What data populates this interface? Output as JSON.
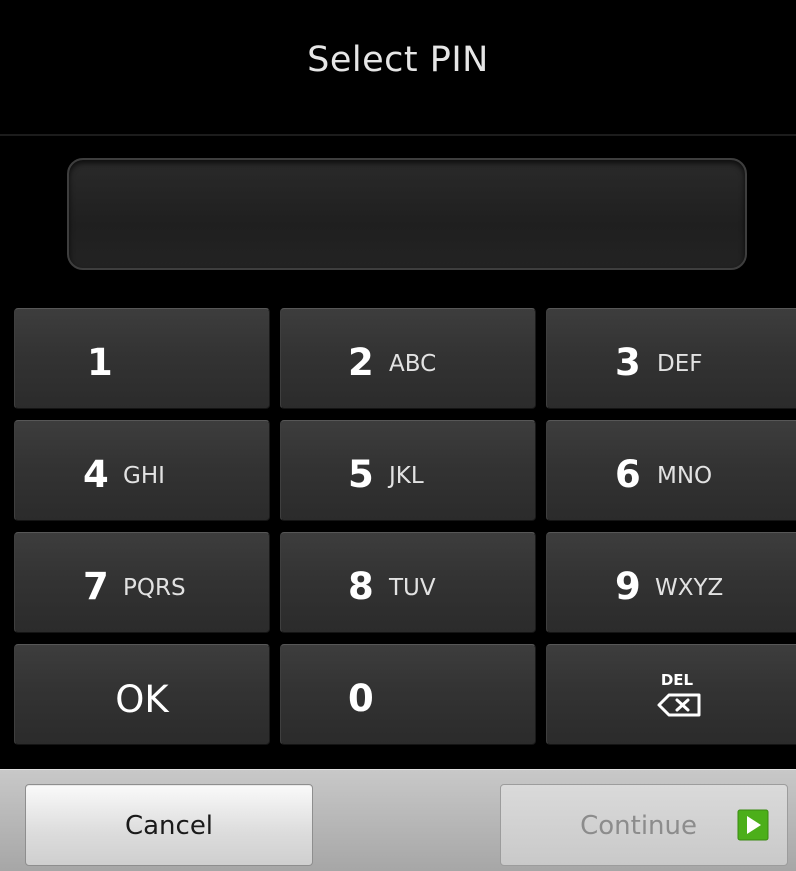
{
  "header": {
    "title": "Select PIN"
  },
  "pin_field": {
    "value": ""
  },
  "keypad": {
    "keys": [
      {
        "digit": "1",
        "letters": ""
      },
      {
        "digit": "2",
        "letters": "ABC"
      },
      {
        "digit": "3",
        "letters": "DEF"
      },
      {
        "digit": "4",
        "letters": "GHI"
      },
      {
        "digit": "5",
        "letters": "JKL"
      },
      {
        "digit": "6",
        "letters": "MNO"
      },
      {
        "digit": "7",
        "letters": "PQRS"
      },
      {
        "digit": "8",
        "letters": "TUV"
      },
      {
        "digit": "9",
        "letters": "WXYZ"
      }
    ],
    "ok_label": "OK",
    "zero_digit": "0",
    "delete_label": "DEL",
    "delete_icon": "backspace-icon"
  },
  "buttons": {
    "cancel_label": "Cancel",
    "continue_label": "Continue",
    "continue_icon": "arrow-right-icon",
    "continue_enabled": false
  },
  "colors": {
    "background": "#000000",
    "key_face": "#333333",
    "continue_arrow": "#4caf1a"
  }
}
